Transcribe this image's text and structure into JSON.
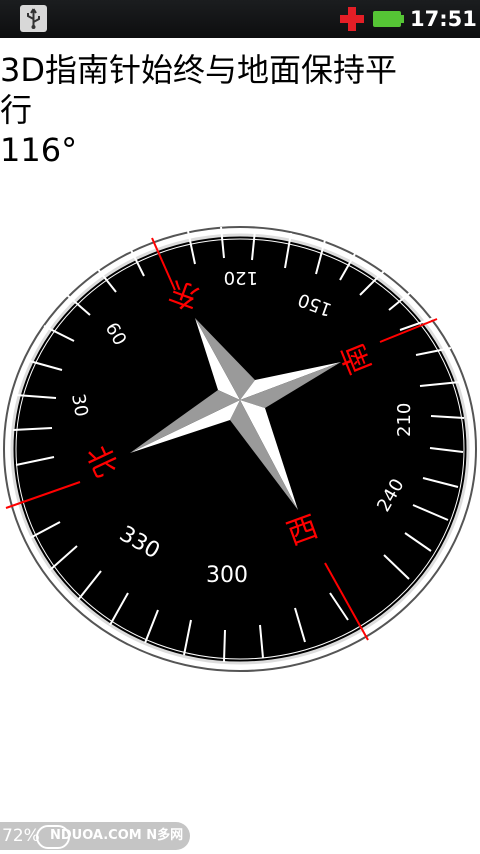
{
  "status_bar": {
    "time": "17:51",
    "icons": [
      "usb-icon",
      "battery-alert-icon",
      "battery-icon"
    ]
  },
  "app": {
    "title_line1": "3D指南针始终与地面保持平",
    "title_line2": "行",
    "heading": "116°"
  },
  "compass": {
    "directions": [
      "北",
      "东",
      "南",
      "西"
    ],
    "degree_labels": [
      "30",
      "60",
      "120",
      "150",
      "210",
      "240",
      "300",
      "330"
    ],
    "colors": {
      "face": "#000000",
      "ring": "#ffffff",
      "direction": "#ff0000",
      "ticks": "#ffffff",
      "needle_light": "#ffffff",
      "needle_dark": "#888888"
    }
  },
  "watermark": {
    "percent": "72%",
    "site": "NDUOA.COM N多网"
  }
}
